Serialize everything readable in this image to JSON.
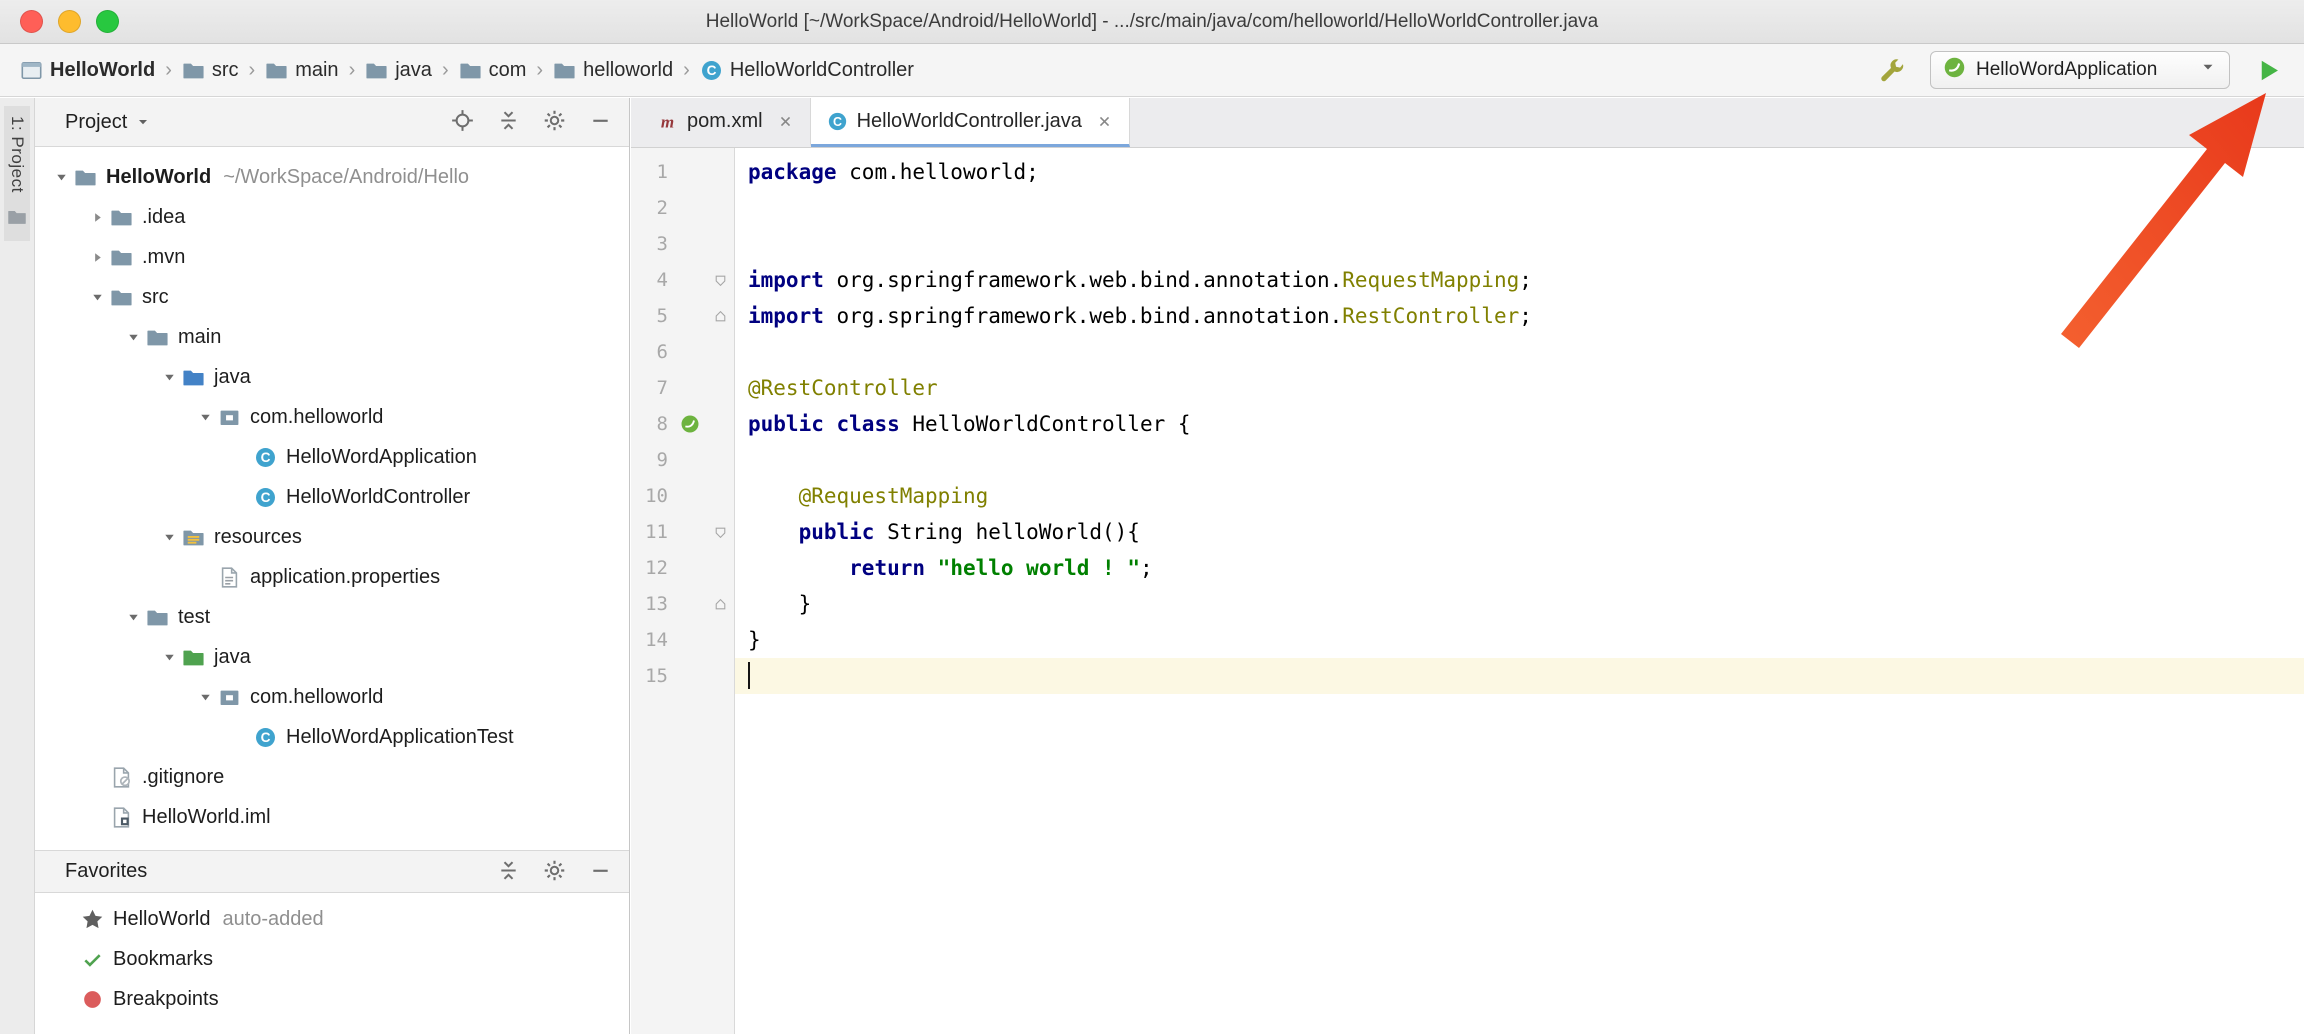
{
  "title_bar": {
    "title": "HelloWorld [~/WorkSpace/Android/HelloWorld] - .../src/main/java/com/helloworld/HelloWorldController.java",
    "window_controls": [
      {
        "name": "close",
        "color": "#FF5F57"
      },
      {
        "name": "minimize",
        "color": "#FEBC2E"
      },
      {
        "name": "zoom",
        "color": "#28C840"
      }
    ]
  },
  "navigation_bar": {
    "breadcrumbs": [
      {
        "label": "HelloWorld",
        "icon": "project-window",
        "bold": true
      },
      {
        "label": "src",
        "icon": "folder"
      },
      {
        "label": "main",
        "icon": "folder"
      },
      {
        "label": "java",
        "icon": "folder"
      },
      {
        "label": "com",
        "icon": "folder"
      },
      {
        "label": "helloworld",
        "icon": "folder"
      },
      {
        "label": "HelloWorldController",
        "icon": "class"
      }
    ],
    "run_toolbar": {
      "build_icon": "wrench",
      "config": {
        "icon": "spring",
        "label": "HelloWordApplication"
      },
      "dropdown_icon": "chevron-down",
      "run_icon": "run-play"
    }
  },
  "stripe": {
    "label": "1: Project",
    "icon": "folder-gray"
  },
  "project_panel": {
    "title": "Project",
    "header_icons": [
      "locate",
      "collapse-all",
      "gear",
      "minimize"
    ],
    "tree": [
      {
        "depth": 0,
        "arrow": "down",
        "icon": "folder",
        "label": "HelloWorld",
        "meta": "~/WorkSpace/Android/Hello",
        "bold": true
      },
      {
        "depth": 1,
        "arrow": "right",
        "icon": "folder",
        "label": ".idea"
      },
      {
        "depth": 1,
        "arrow": "right",
        "icon": "folder",
        "label": ".mvn"
      },
      {
        "depth": 1,
        "arrow": "down",
        "icon": "folder",
        "label": "src"
      },
      {
        "depth": 2,
        "arrow": "down",
        "icon": "folder",
        "label": "main"
      },
      {
        "depth": 3,
        "arrow": "down",
        "icon": "folder-src",
        "label": "java"
      },
      {
        "depth": 4,
        "arrow": "down",
        "icon": "package",
        "label": "com.helloworld"
      },
      {
        "depth": 5,
        "icon": "class",
        "label": "HelloWordApplication",
        "selected": true
      },
      {
        "depth": 5,
        "icon": "class",
        "label": "HelloWorldController"
      },
      {
        "depth": 3,
        "arrow": "down",
        "icon": "folder-resources",
        "label": "resources"
      },
      {
        "depth": 4,
        "icon": "file-properties",
        "label": "application.properties"
      },
      {
        "depth": 2,
        "arrow": "down",
        "icon": "folder",
        "label": "test"
      },
      {
        "depth": 3,
        "arrow": "down",
        "icon": "folder-test",
        "label": "java",
        "green": true
      },
      {
        "depth": 4,
        "arrow": "down",
        "icon": "package",
        "label": "com.helloworld",
        "green": true
      },
      {
        "depth": 5,
        "icon": "class",
        "label": "HelloWordApplicationTest",
        "green": true
      },
      {
        "depth": 1,
        "icon": "file-git",
        "label": ".gitignore"
      },
      {
        "depth": 1,
        "icon": "file-iml",
        "label": "HelloWorld.iml"
      }
    ]
  },
  "favorites_panel": {
    "title": "Favorites",
    "header_icons": [
      "collapse-all",
      "gear",
      "minimize"
    ],
    "items": [
      {
        "icon": "star",
        "label": "HelloWorld",
        "suffix": "auto-added",
        "selected": true
      },
      {
        "icon": "check",
        "label": "Bookmarks"
      },
      {
        "icon": "breakpoint",
        "label": "Breakpoints"
      }
    ]
  },
  "editor": {
    "tabs": [
      {
        "icon": "maven",
        "label": "pom.xml",
        "active": false
      },
      {
        "icon": "class",
        "label": "HelloWorldController.java",
        "active": true
      }
    ],
    "code_lines": [
      {
        "num": 1,
        "tokens": [
          [
            "k",
            "package"
          ],
          [
            "p",
            " com.helloworld;"
          ]
        ]
      },
      {
        "num": 2
      },
      {
        "num": 3
      },
      {
        "num": 4,
        "fold": "open",
        "tokens": [
          [
            "k",
            "import"
          ],
          [
            "p",
            " org.springframework.web.bind.annotation."
          ],
          [
            "a",
            "RequestMapping"
          ],
          [
            "p",
            ";"
          ]
        ]
      },
      {
        "num": 5,
        "fold": "close",
        "tokens": [
          [
            "k",
            "import"
          ],
          [
            "p",
            " org.springframework.web.bind.annotation."
          ],
          [
            "a",
            "RestController"
          ],
          [
            "p",
            ";"
          ]
        ]
      },
      {
        "num": 6
      },
      {
        "num": 7,
        "tokens": [
          [
            "a",
            "@RestController"
          ]
        ]
      },
      {
        "num": 8,
        "gutter": "spring",
        "tokens": [
          [
            "k",
            "public"
          ],
          [
            "p",
            " "
          ],
          [
            "k",
            "class"
          ],
          [
            "p",
            " HelloWorldController {"
          ]
        ]
      },
      {
        "num": 9
      },
      {
        "num": 10,
        "tokens": [
          [
            "p",
            "    "
          ],
          [
            "a",
            "@RequestMapping"
          ]
        ]
      },
      {
        "num": 11,
        "fold": "open",
        "tokens": [
          [
            "p",
            "    "
          ],
          [
            "k",
            "public"
          ],
          [
            "p",
            " String helloWorld(){"
          ]
        ]
      },
      {
        "num": 12,
        "tokens": [
          [
            "p",
            "        "
          ],
          [
            "k",
            "return"
          ],
          [
            "p",
            " "
          ],
          [
            "s",
            "\"hello world ! \""
          ],
          [
            "p",
            ";"
          ]
        ]
      },
      {
        "num": 13,
        "fold": "close",
        "tokens": [
          [
            "p",
            "    }"
          ]
        ]
      },
      {
        "num": 14,
        "tokens": [
          [
            "p",
            "}"
          ]
        ]
      },
      {
        "num": 15,
        "current": true,
        "caret": true
      }
    ]
  },
  "annotation": {
    "arrow_color_start": "#F4602F",
    "arrow_color_end": "#E8391B"
  }
}
